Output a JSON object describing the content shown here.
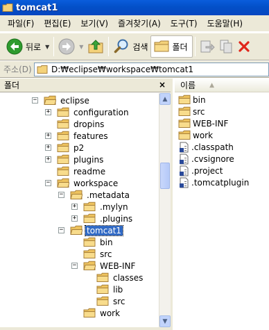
{
  "window": {
    "title": "tomcat1"
  },
  "menu": {
    "items": [
      "파일(F)",
      "편집(E)",
      "보기(V)",
      "즐겨찾기(A)",
      "도구(T)",
      "도움말(H)"
    ]
  },
  "toolbar": {
    "back_label": "뒤로",
    "search_label": "검색",
    "folders_label": "폴더"
  },
  "address": {
    "label": "주소(D)",
    "value": "D:₩eclipse₩workspace₩tomcat1"
  },
  "folder_pane": {
    "title": "폴더",
    "close": "×",
    "tree": [
      {
        "label": "eclipse",
        "expander": "−",
        "depth": 0,
        "open": true
      },
      {
        "label": "configuration",
        "expander": "+",
        "depth": 1
      },
      {
        "label": "dropins",
        "expander": "",
        "depth": 1
      },
      {
        "label": "features",
        "expander": "+",
        "depth": 1
      },
      {
        "label": "p2",
        "expander": "+",
        "depth": 1
      },
      {
        "label": "plugins",
        "expander": "+",
        "depth": 1
      },
      {
        "label": "readme",
        "expander": "",
        "depth": 1
      },
      {
        "label": "workspace",
        "expander": "−",
        "depth": 1,
        "open": true
      },
      {
        "label": ".metadata",
        "expander": "−",
        "depth": 2,
        "open": true
      },
      {
        "label": ".mylyn",
        "expander": "+",
        "depth": 3
      },
      {
        "label": ".plugins",
        "expander": "+",
        "depth": 3
      },
      {
        "label": "tomcat1",
        "expander": "−",
        "depth": 2,
        "open": true,
        "selected": true
      },
      {
        "label": "bin",
        "expander": "",
        "depth": 3
      },
      {
        "label": "src",
        "expander": "",
        "depth": 3
      },
      {
        "label": "WEB-INF",
        "expander": "−",
        "depth": 3,
        "open": true
      },
      {
        "label": "classes",
        "expander": "",
        "depth": 4
      },
      {
        "label": "lib",
        "expander": "",
        "depth": 4
      },
      {
        "label": "src",
        "expander": "",
        "depth": 4
      },
      {
        "label": "work",
        "expander": "",
        "depth": 3
      }
    ]
  },
  "file_list": {
    "column_name": "이름",
    "items": [
      {
        "name": "bin",
        "kind": "folder"
      },
      {
        "name": "src",
        "kind": "folder"
      },
      {
        "name": "WEB-INF",
        "kind": "folder"
      },
      {
        "name": "work",
        "kind": "folder"
      },
      {
        "name": ".classpath",
        "kind": "file"
      },
      {
        "name": ".cvsignore",
        "kind": "file"
      },
      {
        "name": ".project",
        "kind": "file"
      },
      {
        "name": ".tomcatplugin",
        "kind": "file"
      }
    ]
  },
  "icons": {
    "folder": "folder-icon",
    "file": "document-icon",
    "back": "back-arrow-icon",
    "forward": "forward-arrow-icon",
    "up": "up-folder-icon",
    "search": "search-icon",
    "folders": "folders-icon",
    "move": "move-to-icon",
    "copy": "copy-to-icon",
    "delete": "delete-icon"
  },
  "colors": {
    "titlebar": "#0350c8",
    "chrome": "#ece9d8",
    "selection": "#316ac5",
    "folder": "#f4d27a"
  }
}
